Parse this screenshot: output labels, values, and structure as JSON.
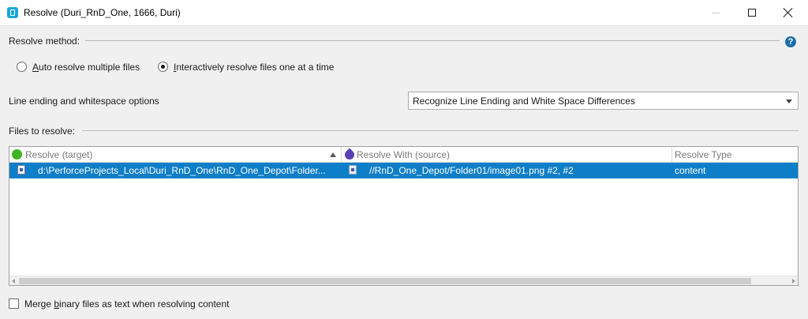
{
  "window": {
    "title": "Resolve (Duri_RnD_One,  1666,  Duri)",
    "icon": "p4v-app-icon"
  },
  "resolve_method": {
    "label": "Resolve method:",
    "help_icon": "help-icon",
    "options": [
      {
        "label_pre": "",
        "label_accel": "A",
        "label_post": "uto resolve multiple files",
        "checked": false
      },
      {
        "label_pre": "",
        "label_accel": "I",
        "label_post": "nteractively resolve files one at a time",
        "checked": true
      }
    ]
  },
  "line_ending": {
    "label": "Line ending and whitespace options",
    "selected": "Recognize Line Ending and White Space Differences"
  },
  "files": {
    "label": "Files to resolve:",
    "columns": [
      "Resolve (target)",
      "Resolve With (source)",
      "Resolve Type"
    ],
    "rows": [
      {
        "target": "d:\\PerforceProjects_Local\\Duri_RnD_One\\RnD_One_Depot\\Folder...",
        "source": "//RnD_One_Depot/Folder01/image01.png #2, #2",
        "type": "content",
        "selected": true
      }
    ]
  },
  "merge_binary": {
    "label_pre": "Merge ",
    "label_accel": "b",
    "label_post": "inary files as text when resolving content",
    "checked": false
  },
  "colors": {
    "selection": "#0e7ec8",
    "target_marker": "#3cb521",
    "source_marker": "#5a3fb5",
    "help": "#1e6fa8"
  }
}
